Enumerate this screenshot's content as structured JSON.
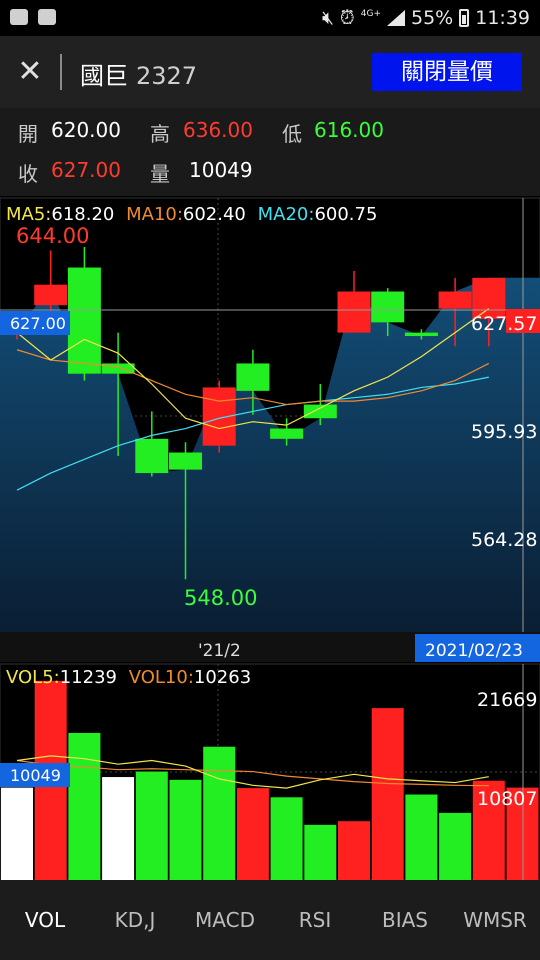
{
  "status_bar": {
    "icons": [
      "photo-icon",
      "youtube-icon",
      "mute-icon",
      "alarm-icon",
      "signal-icon",
      "battery-icon"
    ],
    "network": "4G+",
    "battery": "55%",
    "time": "11:39"
  },
  "header": {
    "stock_name": "國巨",
    "stock_code": "2327",
    "toggle_label": "關閉量價"
  },
  "quote": {
    "open_label": "開",
    "open": "620.00",
    "high_label": "高",
    "high": "636.00",
    "low_label": "低",
    "low": "616.00",
    "close_label": "收",
    "close": "627.00",
    "volume_label": "量",
    "volume": "10049"
  },
  "colors": {
    "up": "#ff2020",
    "down": "#22ee22",
    "ma5": "#f2e64a",
    "ma10": "#f08a30",
    "ma20": "#40e0f0",
    "area_top": "#134e78",
    "area_bottom": "#0a1e33",
    "date_tag": "#1466e0"
  },
  "price_panel": {
    "ma5_label": "MA5:",
    "ma5": "618.20",
    "ma10_label": "MA10:",
    "ma10": "602.40",
    "ma20_label": "MA20:",
    "ma20": "600.75",
    "max_label": "644.00",
    "min_label": "548.00",
    "current_tag": "627.00",
    "axis_labels": [
      "627.57",
      "595.93",
      "564.28"
    ],
    "x_label": "'21/2",
    "date_tag": "2021/02/23"
  },
  "volume_panel": {
    "vol5_label": "VOL5:",
    "vol5": "11239",
    "vol10_label": "VOL10:",
    "vol10": "10263",
    "current_tag": "10049",
    "axis_labels": [
      "21669",
      "10807"
    ]
  },
  "chart_data": {
    "type": "candlestick",
    "price_range": [
      532.6,
      659.3
    ],
    "candles": [
      {
        "o": 621,
        "c": 620,
        "h": 622,
        "l": 618,
        "dir": "up"
      },
      {
        "o": 628,
        "c": 634,
        "h": 644,
        "l": 625,
        "dir": "up"
      },
      {
        "o": 639,
        "c": 608,
        "h": 645,
        "l": 606,
        "dir": "down"
      },
      {
        "o": 611,
        "c": 608,
        "h": 620,
        "l": 584,
        "dir": "down"
      },
      {
        "o": 589,
        "c": 579,
        "h": 597,
        "l": 578,
        "dir": "down"
      },
      {
        "o": 585,
        "c": 580,
        "h": 588,
        "l": 548,
        "dir": "down"
      },
      {
        "o": 587,
        "c": 604,
        "h": 606,
        "l": 585,
        "dir": "up"
      },
      {
        "o": 611,
        "c": 603,
        "h": 615,
        "l": 596,
        "dir": "down"
      },
      {
        "o": 592,
        "c": 589,
        "h": 595,
        "l": 587,
        "dir": "down"
      },
      {
        "o": 599,
        "c": 595,
        "h": 605,
        "l": 593,
        "dir": "down"
      },
      {
        "o": 620,
        "c": 632,
        "h": 638,
        "l": 620,
        "dir": "up"
      },
      {
        "o": 632,
        "c": 623,
        "h": 633,
        "l": 619,
        "dir": "down"
      },
      {
        "o": 620,
        "c": 619,
        "h": 621,
        "l": 618,
        "dir": "down"
      },
      {
        "o": 627,
        "c": 632,
        "h": 636,
        "l": 616,
        "dir": "up"
      },
      {
        "o": 624,
        "c": 636,
        "h": 636,
        "l": 616,
        "dir": "up"
      }
    ],
    "ma5": [
      620,
      612,
      618,
      614,
      605,
      595,
      592,
      594,
      593,
      598,
      603,
      607,
      613,
      620,
      627
    ],
    "ma10": [
      615,
      612,
      611,
      610,
      606,
      602,
      600,
      601,
      599,
      600,
      600,
      601,
      603,
      606,
      611
    ],
    "ma20": [
      574,
      579,
      583,
      587,
      590,
      592,
      595,
      597,
      599,
      600,
      601,
      602,
      604,
      605,
      607
    ],
    "volume_max": 23500,
    "volumes": [
      {
        "v": 10049,
        "dir": "flat"
      },
      {
        "v": 21669,
        "dir": "up"
      },
      {
        "v": 16000,
        "dir": "down"
      },
      {
        "v": 11200,
        "dir": "flat"
      },
      {
        "v": 11800,
        "dir": "down"
      },
      {
        "v": 10900,
        "dir": "down"
      },
      {
        "v": 14500,
        "dir": "down"
      },
      {
        "v": 10000,
        "dir": "up"
      },
      {
        "v": 9000,
        "dir": "down"
      },
      {
        "v": 6000,
        "dir": "down"
      },
      {
        "v": 6400,
        "dir": "up"
      },
      {
        "v": 18700,
        "dir": "up"
      },
      {
        "v": 9300,
        "dir": "down"
      },
      {
        "v": 7300,
        "dir": "down"
      },
      {
        "v": 10800,
        "dir": "up"
      },
      {
        "v": 10049,
        "dir": "up"
      }
    ],
    "vol5": [
      13000,
      13500,
      13200,
      12600,
      13000,
      12400,
      11000,
      10300,
      10000,
      10900,
      11500,
      11000,
      10800,
      10600,
      11239
    ],
    "vol10": [
      13000,
      12500,
      12300,
      12000,
      12100,
      12000,
      11900,
      11800,
      11300,
      11000,
      10700,
      10500,
      10400,
      10300,
      10263
    ]
  },
  "tabs": [
    "VOL",
    "KD,J",
    "MACD",
    "RSI",
    "BIAS",
    "WMSR"
  ]
}
